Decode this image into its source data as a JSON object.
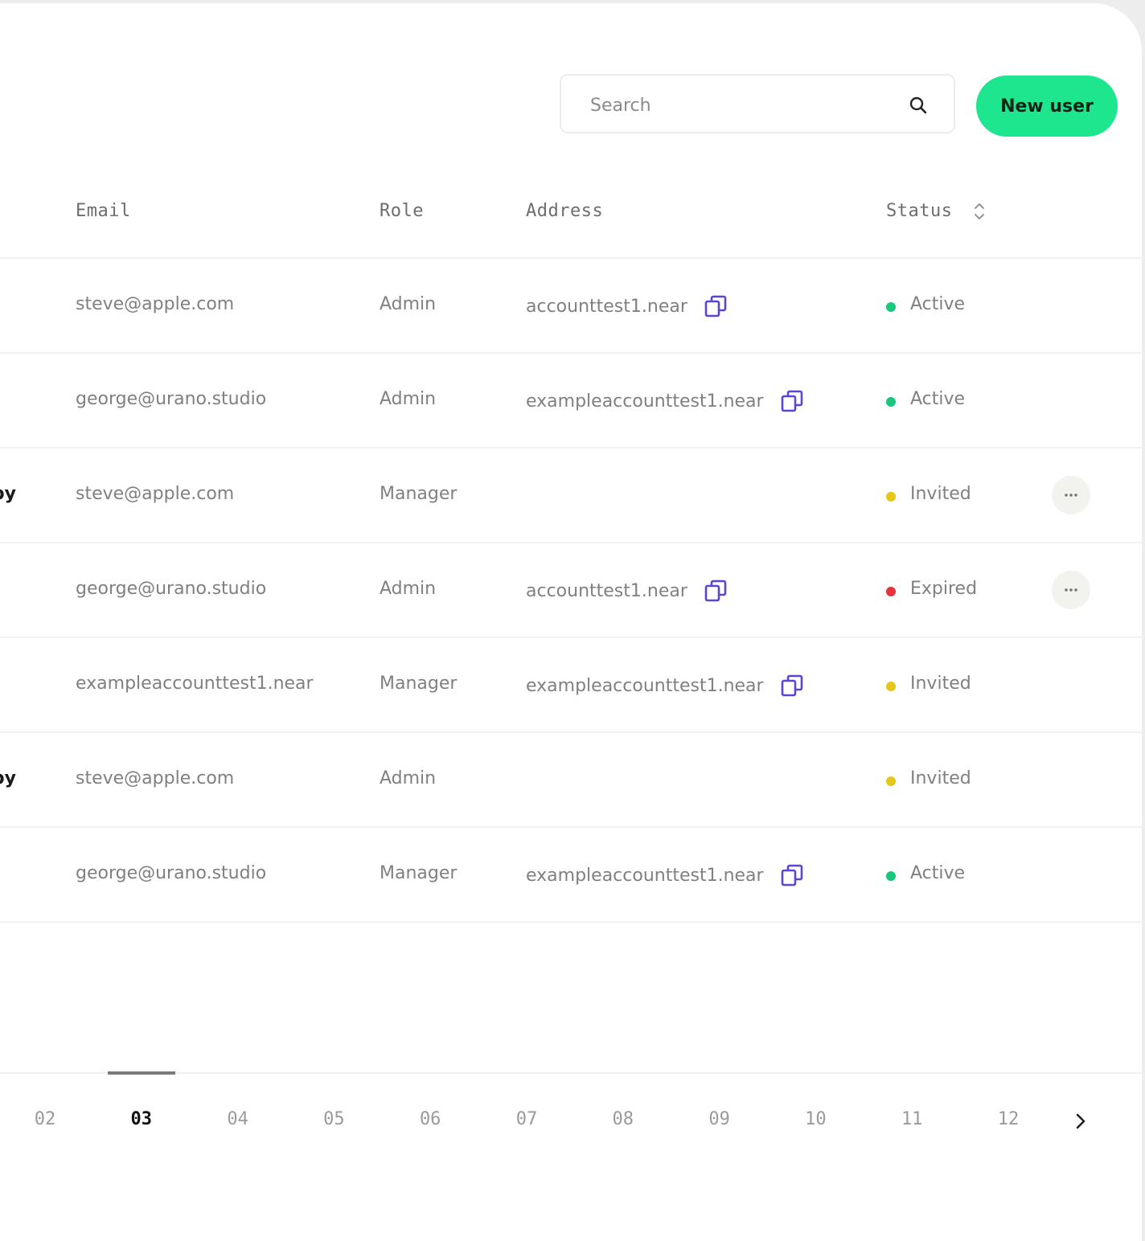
{
  "toolbar": {
    "search_placeholder": "Search",
    "new_user_label": "New user",
    "accent_color": "#1ee68f"
  },
  "table": {
    "columns": {
      "email": "Email",
      "role": "Role",
      "address": "Address",
      "status": "Status"
    },
    "status_colors": {
      "Active": "#17c77d",
      "Invited": "#e6c619",
      "Expired": "#e8333a"
    },
    "icon_color": "#5a46d6",
    "rows": [
      {
        "name": "",
        "email": "steve@apple.com",
        "role": "Admin",
        "address": "accounttest1.near",
        "status": "Active",
        "has_menu": false
      },
      {
        "name": "",
        "email": "george@urano.studio",
        "role": "Admin",
        "address": "exampleaccounttest1.near",
        "status": "Active",
        "has_menu": false
      },
      {
        "name": "py",
        "email": "steve@apple.com",
        "role": "Manager",
        "address": "",
        "status": "Invited",
        "has_menu": true
      },
      {
        "name": "",
        "email": "george@urano.studio",
        "role": "Admin",
        "address": "accounttest1.near",
        "status": "Expired",
        "has_menu": true
      },
      {
        "name": "",
        "email": "exampleaccounttest1.near",
        "role": "Manager",
        "address": "exampleaccounttest1.near",
        "status": "Invited",
        "has_menu": false
      },
      {
        "name": "py",
        "email": "steve@apple.com",
        "role": "Admin",
        "address": "",
        "status": "Invited",
        "has_menu": false
      },
      {
        "name": "",
        "email": "george@urano.studio",
        "role": "Manager",
        "address": "exampleaccounttest1.near",
        "status": "Active",
        "has_menu": false
      }
    ]
  },
  "pagination": {
    "pages": [
      "02",
      "03",
      "04",
      "05",
      "06",
      "07",
      "08",
      "09",
      "10",
      "11",
      "12"
    ],
    "current": "03"
  }
}
